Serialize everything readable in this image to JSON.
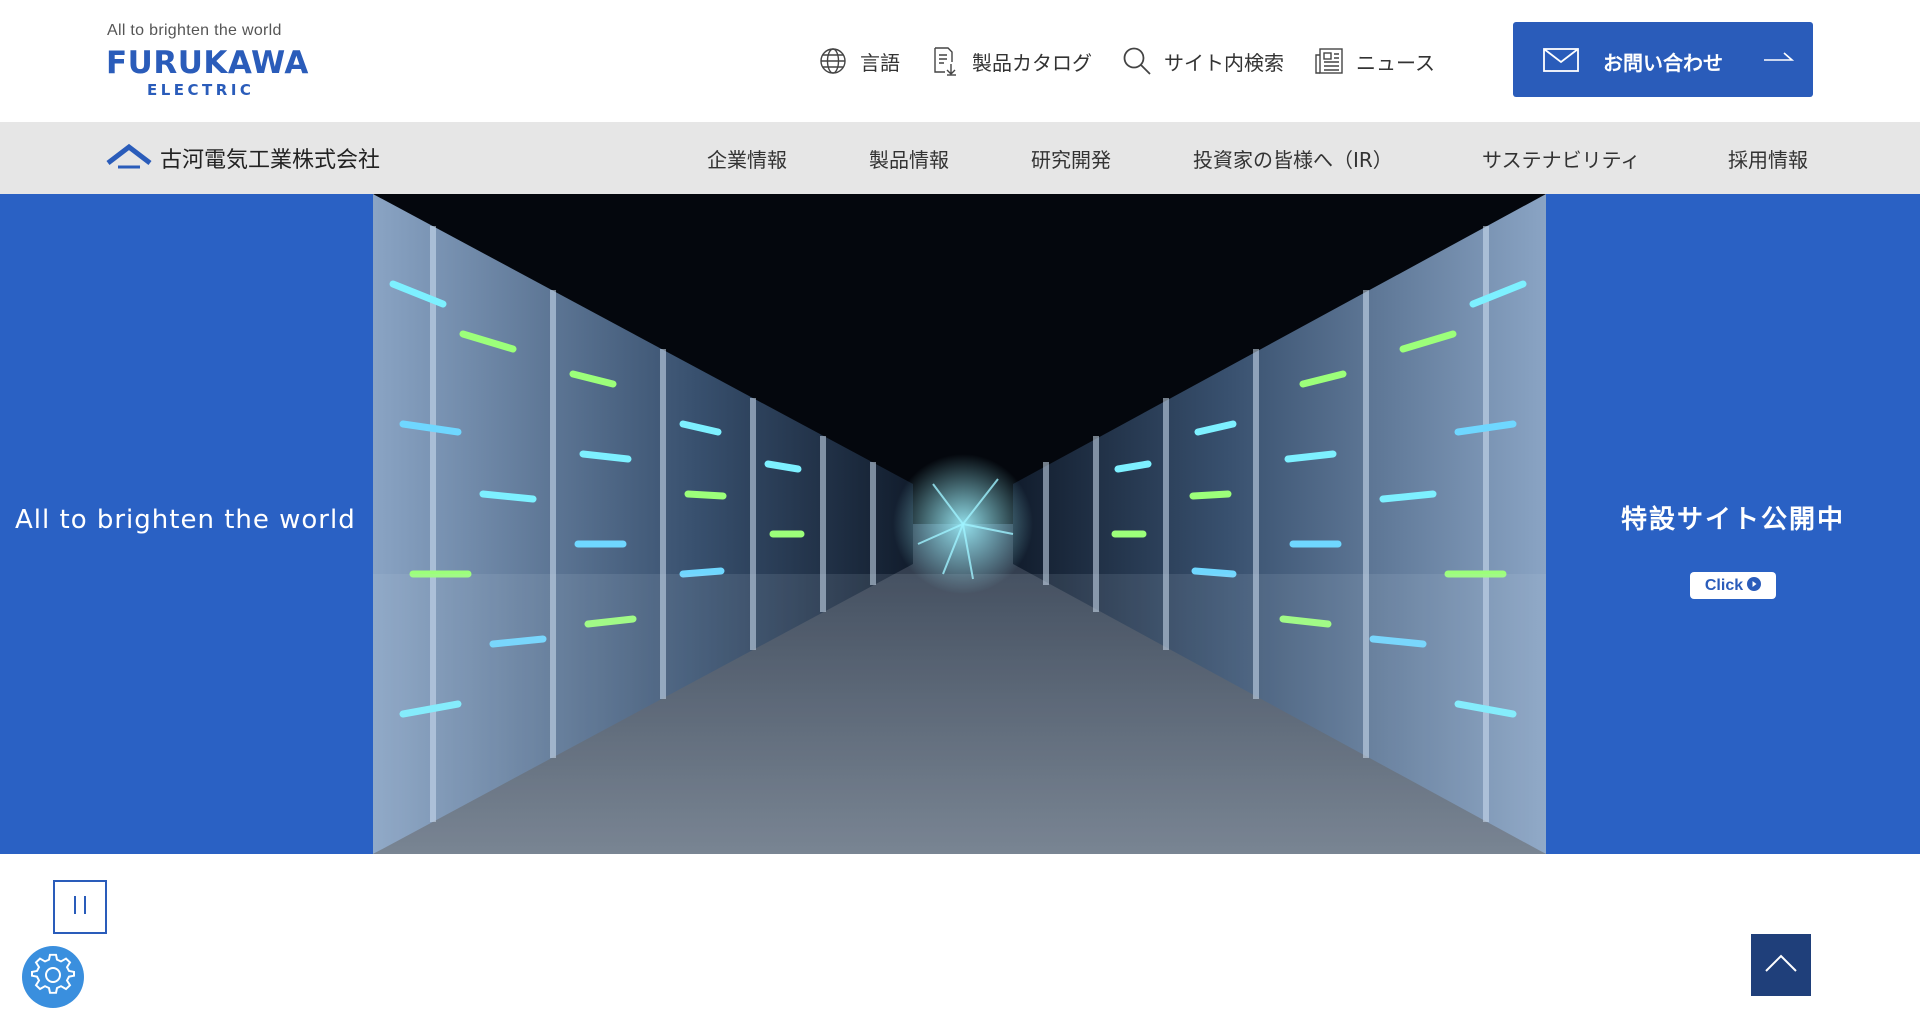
{
  "header": {
    "logo": {
      "tagline": "All to brighten the world",
      "name": "FURUKAWA",
      "sub": "ELECTRIC"
    },
    "utility_nav": [
      {
        "label": "言語",
        "icon": "globe-icon"
      },
      {
        "label": "製品カタログ",
        "icon": "catalog-download-icon"
      },
      {
        "label": "サイト内検索",
        "icon": "search-icon"
      },
      {
        "label": "ニュース",
        "icon": "news-icon"
      }
    ],
    "contact": {
      "label": "お問い合わせ",
      "icon": "mail-icon"
    }
  },
  "global_nav": {
    "company_name": "古河電気工業株式会社",
    "items": [
      {
        "label": "企業情報"
      },
      {
        "label": "製品情報"
      },
      {
        "label": "研究開発"
      },
      {
        "label": "投資家の皆様へ（IR）"
      },
      {
        "label": "サステナビリティ"
      },
      {
        "label": "採用情報"
      }
    ]
  },
  "hero": {
    "left_text": "All to brighten the world",
    "right_text": "特設サイト公開中",
    "click_label": "Click"
  },
  "controls": {
    "pause_icon": "pause-icon",
    "settings_icon": "gear-icon",
    "back_to_top_icon": "chevron-up-icon"
  },
  "colors": {
    "brand_blue": "#2a5cba",
    "hero_blue": "#2a61c4",
    "nav_gray": "#e6e6e6",
    "settings_blue": "#3a8fde",
    "top_button_navy": "#1f3f7a"
  }
}
